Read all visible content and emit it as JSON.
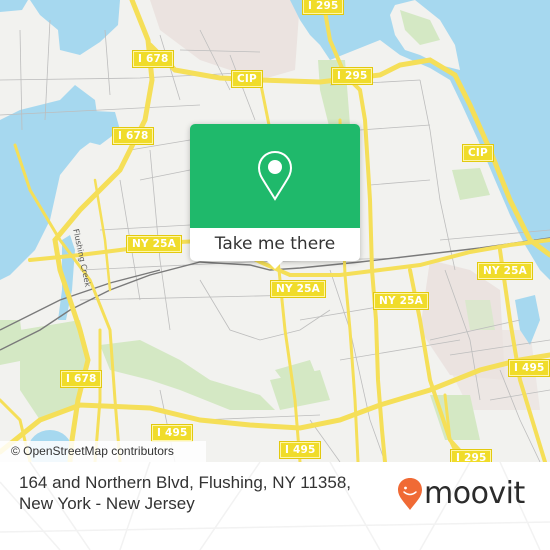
{
  "map": {
    "attribution": "© OpenStreetMap contributors",
    "creek_label": "Flushing Creek",
    "shields": [
      {
        "id": "i678-north",
        "label": "I 678"
      },
      {
        "id": "cip-north",
        "label": "CIP"
      },
      {
        "id": "i295-top",
        "label": "I 295"
      },
      {
        "id": "i295-mid",
        "label": "I 295"
      },
      {
        "id": "i678-mid",
        "label": "I 678"
      },
      {
        "id": "cip-east",
        "label": "CIP"
      },
      {
        "id": "ny25a-west",
        "label": "NY 25A"
      },
      {
        "id": "ny25a-center",
        "label": "NY 25A"
      },
      {
        "id": "ny25a-mid",
        "label": "NY 25A"
      },
      {
        "id": "ny25a-east",
        "label": "NY 25A"
      },
      {
        "id": "i495-east",
        "label": "I 495"
      },
      {
        "id": "i678-south",
        "label": "I 678"
      },
      {
        "id": "i495-center",
        "label": "I 495"
      },
      {
        "id": "i495-west",
        "label": "I 495"
      },
      {
        "id": "i295-south",
        "label": "I 295"
      }
    ],
    "colors": {
      "land": "#f2f2ef",
      "water": "#a6d8ef",
      "park": "#d4e8c4",
      "urban": "#ebe3e0",
      "highway": "#f5df58",
      "shield": "#f0dc2a",
      "rail": "#7a7a7a"
    }
  },
  "popup": {
    "icon": "location-pin-icon",
    "cta_label": "Take me there",
    "color": "#1fb96b"
  },
  "footer": {
    "address": "164 and Northern Blvd, Flushing, NY 11358, New York - New Jersey",
    "brand": "moovit",
    "brand_color": "#f06a35"
  }
}
